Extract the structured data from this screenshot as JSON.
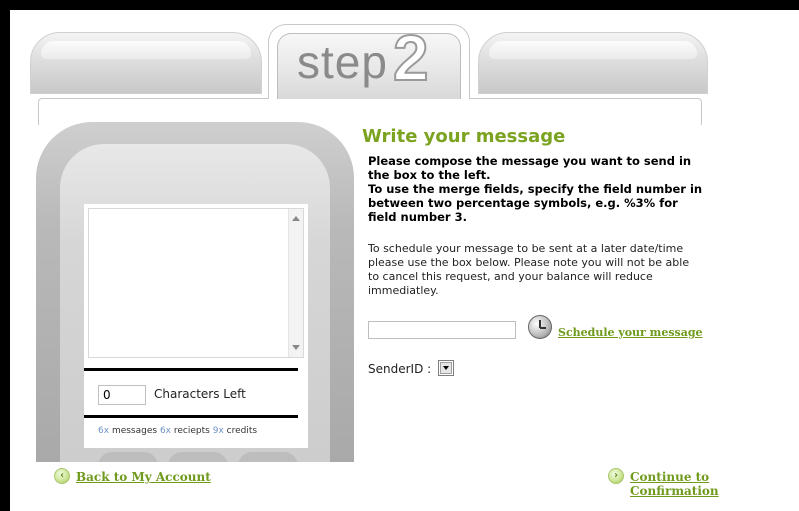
{
  "header": {
    "step_word": "step",
    "step_number": "2"
  },
  "phone": {
    "message_text": "",
    "char_count": "0",
    "chars_left_label": "Characters Left",
    "counts": {
      "messages_n": "6x",
      "messages_label": "messages",
      "receipts_n": "6x",
      "receipts_label": "reciepts",
      "credits_n": "9x",
      "credits_label": "credits"
    }
  },
  "main": {
    "title": "Write your message",
    "instructions_1": "Please compose the message you want to send in the box to the left.",
    "instructions_2": "To use the merge fields, specify the field number in between two percentage symbols, e.g. %3% for field number 3.",
    "schedule_text": "To schedule your message to be sent at a later date/time please use the box below. Please note you will not be able to cancel this request, and your balance will reduce immediatley.",
    "schedule_value": "",
    "schedule_link": "Schedule your message",
    "sender_label": "SenderID :",
    "sender_selected": ""
  },
  "footer": {
    "back_label": "Back to My Account",
    "continue_label": "Continue to Confirmation",
    "back_icon": "back-arrow-icon",
    "continue_icon": "forward-arrow-icon"
  },
  "colors": {
    "accent_green": "#7ba320",
    "link_green": "#6f9a1c",
    "count_blue": "#6f93c6"
  }
}
